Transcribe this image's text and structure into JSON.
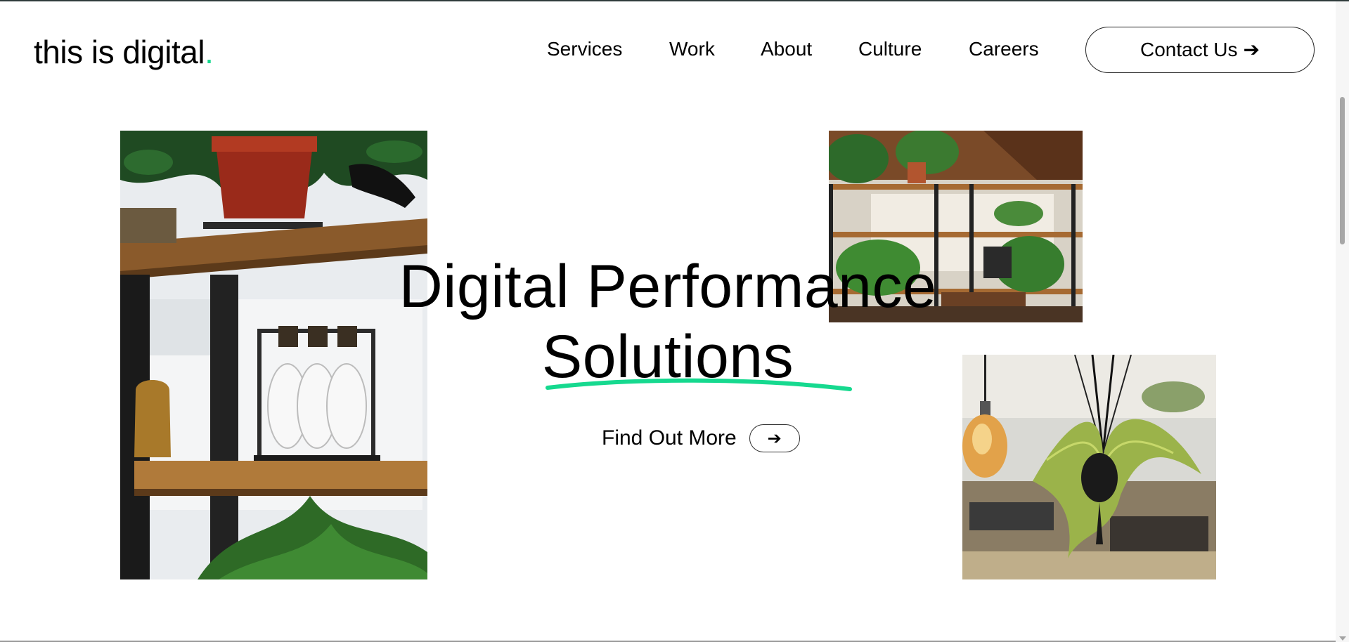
{
  "header": {
    "logo_text": "this is digital",
    "logo_dot": ".",
    "nav": {
      "services": "Services",
      "work": "Work",
      "about": "About",
      "culture": "Culture",
      "careers": "Careers"
    },
    "contact_label": "Contact Us",
    "contact_icon": "arrow-right-icon"
  },
  "hero": {
    "title_line1": "Digital Performance",
    "title_line2": "Solutions",
    "cta_label": "Find Out More",
    "cta_icon": "arrow-right-icon",
    "images": [
      "shelf-with-plants-and-glass-bottles",
      "office-with-shelves-and-plants",
      "hanging-plant-and-edison-bulb"
    ]
  },
  "colors": {
    "accent": "#16d98f",
    "text": "#000000",
    "background": "#ffffff"
  }
}
